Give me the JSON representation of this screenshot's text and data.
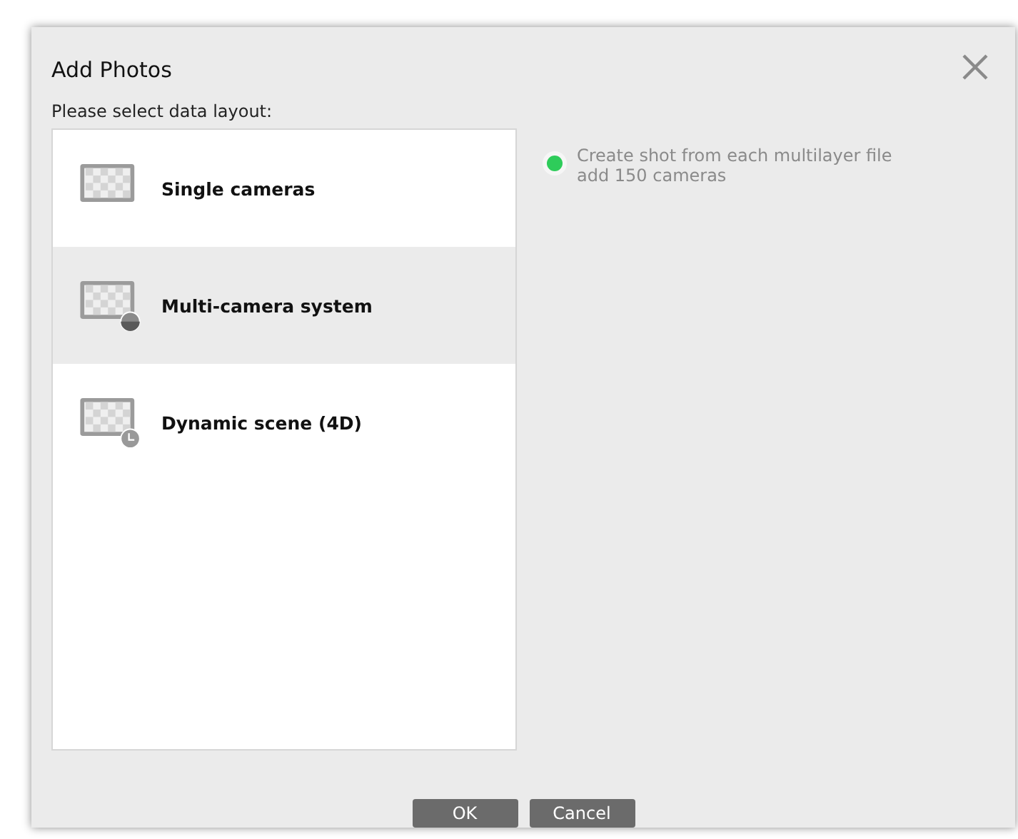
{
  "dialog": {
    "title": "Add Photos",
    "prompt": "Please select data layout:",
    "layouts": [
      {
        "label": "Single cameras",
        "kind": "single",
        "selected": false
      },
      {
        "label": "Multi-camera system",
        "kind": "multi",
        "selected": true
      },
      {
        "label": "Dynamic scene (4D)",
        "kind": "dynamic",
        "selected": false
      }
    ],
    "info": {
      "color": "#2ecc5a",
      "lines": [
        "Create shot from each multilayer file",
        "add 150 cameras"
      ]
    },
    "buttons": [
      "OK",
      "Cancel"
    ]
  }
}
